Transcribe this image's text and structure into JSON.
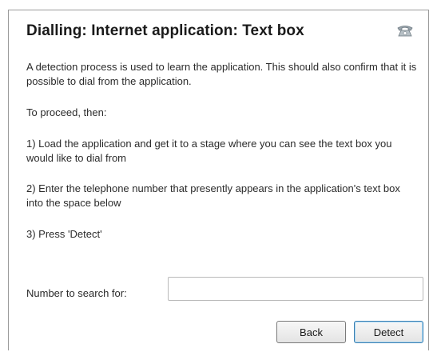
{
  "dialog": {
    "title": "Dialling: Internet application: Text box",
    "icon": "phone-icon",
    "paragraphs": [
      "A detection process is used to learn the application. This should also confirm that it is possible to dial from the application.",
      "To proceed, then:",
      "1) Load the application and get it to a stage where you can see the text box you would like to dial from",
      "2) Enter the telephone number that presently appears in the application's text box into the space below",
      "3) Press 'Detect'"
    ],
    "search": {
      "label": "Number to search for:",
      "value": "",
      "placeholder": ""
    },
    "buttons": {
      "back": "Back",
      "detect": "Detect"
    }
  }
}
